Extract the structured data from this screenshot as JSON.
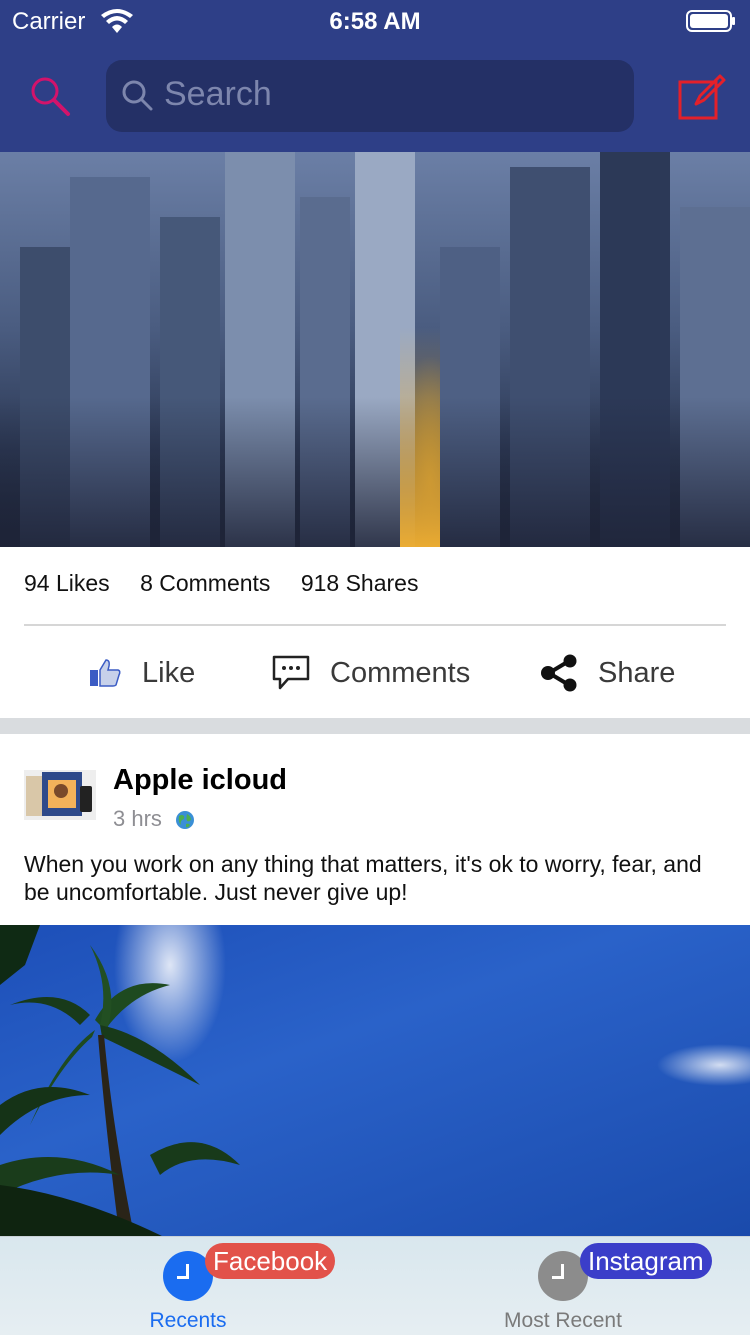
{
  "status_bar": {
    "carrier": "Carrier",
    "time": "6:58 AM"
  },
  "header": {
    "search_placeholder": "Search",
    "background_color": "#2e3f87",
    "accent_color": "#d3136b",
    "compose_color": "#e4202a"
  },
  "post1": {
    "image": "city-night-skyline",
    "stats": {
      "likes": "94 Likes",
      "comments": "8 Comments",
      "shares": "918 Shares"
    },
    "actions": {
      "like": "Like",
      "comments": "Comments",
      "share": "Share"
    }
  },
  "post2": {
    "author": "Apple icloud",
    "time": "3 hrs",
    "text": "When you work on any thing that matters, it's ok to worry, fear, and be uncomfortable. Just never give up!",
    "image": "palm-trees-blue-sky"
  },
  "tabbar": {
    "tabs": [
      {
        "label": "Recents",
        "badge": "Facebook",
        "active": true,
        "icon": "clock-icon"
      },
      {
        "label": "Most Recent",
        "badge": "Instagram",
        "active": false,
        "icon": "clock-icon"
      }
    ]
  }
}
